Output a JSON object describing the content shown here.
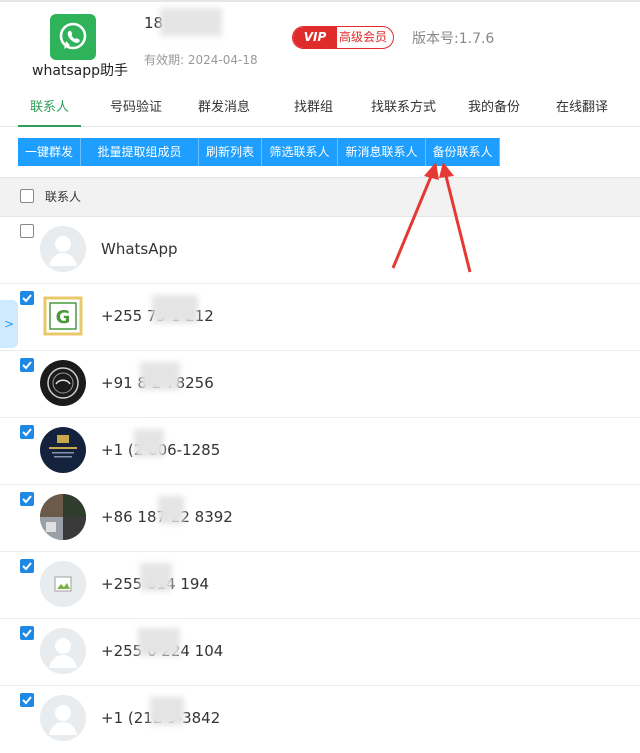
{
  "header": {
    "app_name": "whatsapp助手",
    "phone_prefix": "18",
    "validity": "有效期: 2024-04-18",
    "vip_tag": "VIP",
    "vip_label": "高级会员",
    "version": "版本号:1.7.6"
  },
  "tabs": [
    {
      "label": "联系人",
      "active": true
    },
    {
      "label": "号码验证"
    },
    {
      "label": "群发消息"
    },
    {
      "label": "找群组"
    },
    {
      "label": "找联系方式"
    },
    {
      "label": "我的备份"
    },
    {
      "label": "在线翻译"
    }
  ],
  "toolbar": [
    {
      "label": "一键群发"
    },
    {
      "label": "批量提取组成员"
    },
    {
      "label": "刷新列表"
    },
    {
      "label": "筛选联系人"
    },
    {
      "label": "新消息联系人"
    },
    {
      "label": "备份联系人"
    }
  ],
  "table": {
    "header_label": "联系人",
    "rows": [
      {
        "name": "WhatsApp",
        "checked": false,
        "avatar": "default"
      },
      {
        "name": "+255 75      1 212",
        "checked": true,
        "avatar": "g-logo"
      },
      {
        "name": "+91 8      2 78256",
        "checked": true,
        "avatar": "dark-emblem"
      },
      {
        "name": "+1 (2      606-1285",
        "checked": true,
        "avatar": "navy-card"
      },
      {
        "name": "+86 187      22 8392",
        "checked": true,
        "avatar": "photo-collage"
      },
      {
        "name": "+255      014 194",
        "checked": true,
        "avatar": "broken-image"
      },
      {
        "name": "+255 6      224 104",
        "checked": true,
        "avatar": "default"
      },
      {
        "name": "+1 (212      9-3842",
        "checked": true,
        "avatar": "default"
      }
    ]
  },
  "colors": {
    "accent_green": "#2c9f5a",
    "button_blue": "#1e9fff",
    "vip_red": "#e02b2b",
    "arrow_red": "#e53935"
  }
}
